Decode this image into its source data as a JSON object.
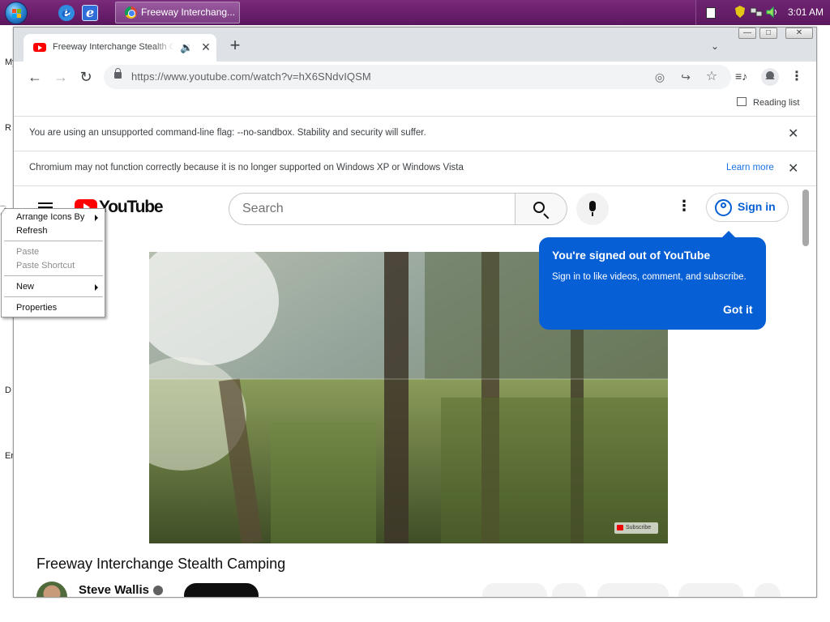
{
  "taskbar": {
    "task_label": "Freeway Interchang...",
    "clock": "3:01 AM"
  },
  "desktop": {
    "labels": [
      "My",
      "R",
      "D",
      "Er"
    ]
  },
  "browser": {
    "tab_title": "Freeway Interchange Stealth Ca",
    "url": "https://www.youtube.com/watch?v=hX6SNdvIQSM",
    "reading_list": "Reading list",
    "infobar_flag": "You are using an unsupported command-line flag: --no-sandbox. Stability and security will suffer.",
    "infobar_support": "Chromium may not function correctly because it is no longer supported on Windows XP or Windows Vista",
    "learn_more": "Learn more",
    "window_controls": {
      "minimize": "—",
      "maximize": "□",
      "close": "✕"
    }
  },
  "youtube": {
    "logo_text": "YouTube",
    "search_placeholder": "Search",
    "sign_in": "Sign in",
    "tooltip": {
      "title": "You're signed out of YouTube",
      "body": "Sign in to like videos, comment, and subscribe.",
      "action": "Got it"
    },
    "watermark": "Subscribe",
    "video_title": "Freeway Interchange Stealth Camping",
    "channel_name": "Steve Wallis"
  },
  "context_menu": {
    "items": [
      {
        "label": "Arrange Icons By",
        "enabled": true,
        "submenu": true
      },
      {
        "label": "Refresh",
        "enabled": true,
        "submenu": false
      },
      {
        "label": "Paste",
        "enabled": false,
        "submenu": false
      },
      {
        "label": "Paste Shortcut",
        "enabled": false,
        "submenu": false
      },
      {
        "label": "New",
        "enabled": true,
        "submenu": true
      },
      {
        "label": "Properties",
        "enabled": true,
        "submenu": false
      }
    ]
  },
  "icons": {
    "start": "windows-start-orb",
    "quicklaunch": [
      "internet-explorer-icon",
      "internet-explorer-alt-icon"
    ],
    "tray": [
      "keyboard-icon",
      "security-shield-icon",
      "network-icon",
      "volume-icon"
    ],
    "browser": [
      "youtube-favicon",
      "audio-playing-icon",
      "tab-close-icon",
      "new-tab-icon",
      "tab-search-icon",
      "back-icon",
      "forward-icon",
      "reload-icon",
      "lock-icon",
      "eye-off-icon",
      "share-icon",
      "bookmark-star-icon",
      "media-control-icon",
      "profile-icon",
      "menu-icon",
      "reading-list-icon",
      "infobar-close-icon"
    ]
  },
  "colors": {
    "taskbar": "#6a1f6c",
    "youtube_red": "#ff0000",
    "youtube_blue": "#065fd4",
    "link_blue": "#1a73e8"
  }
}
